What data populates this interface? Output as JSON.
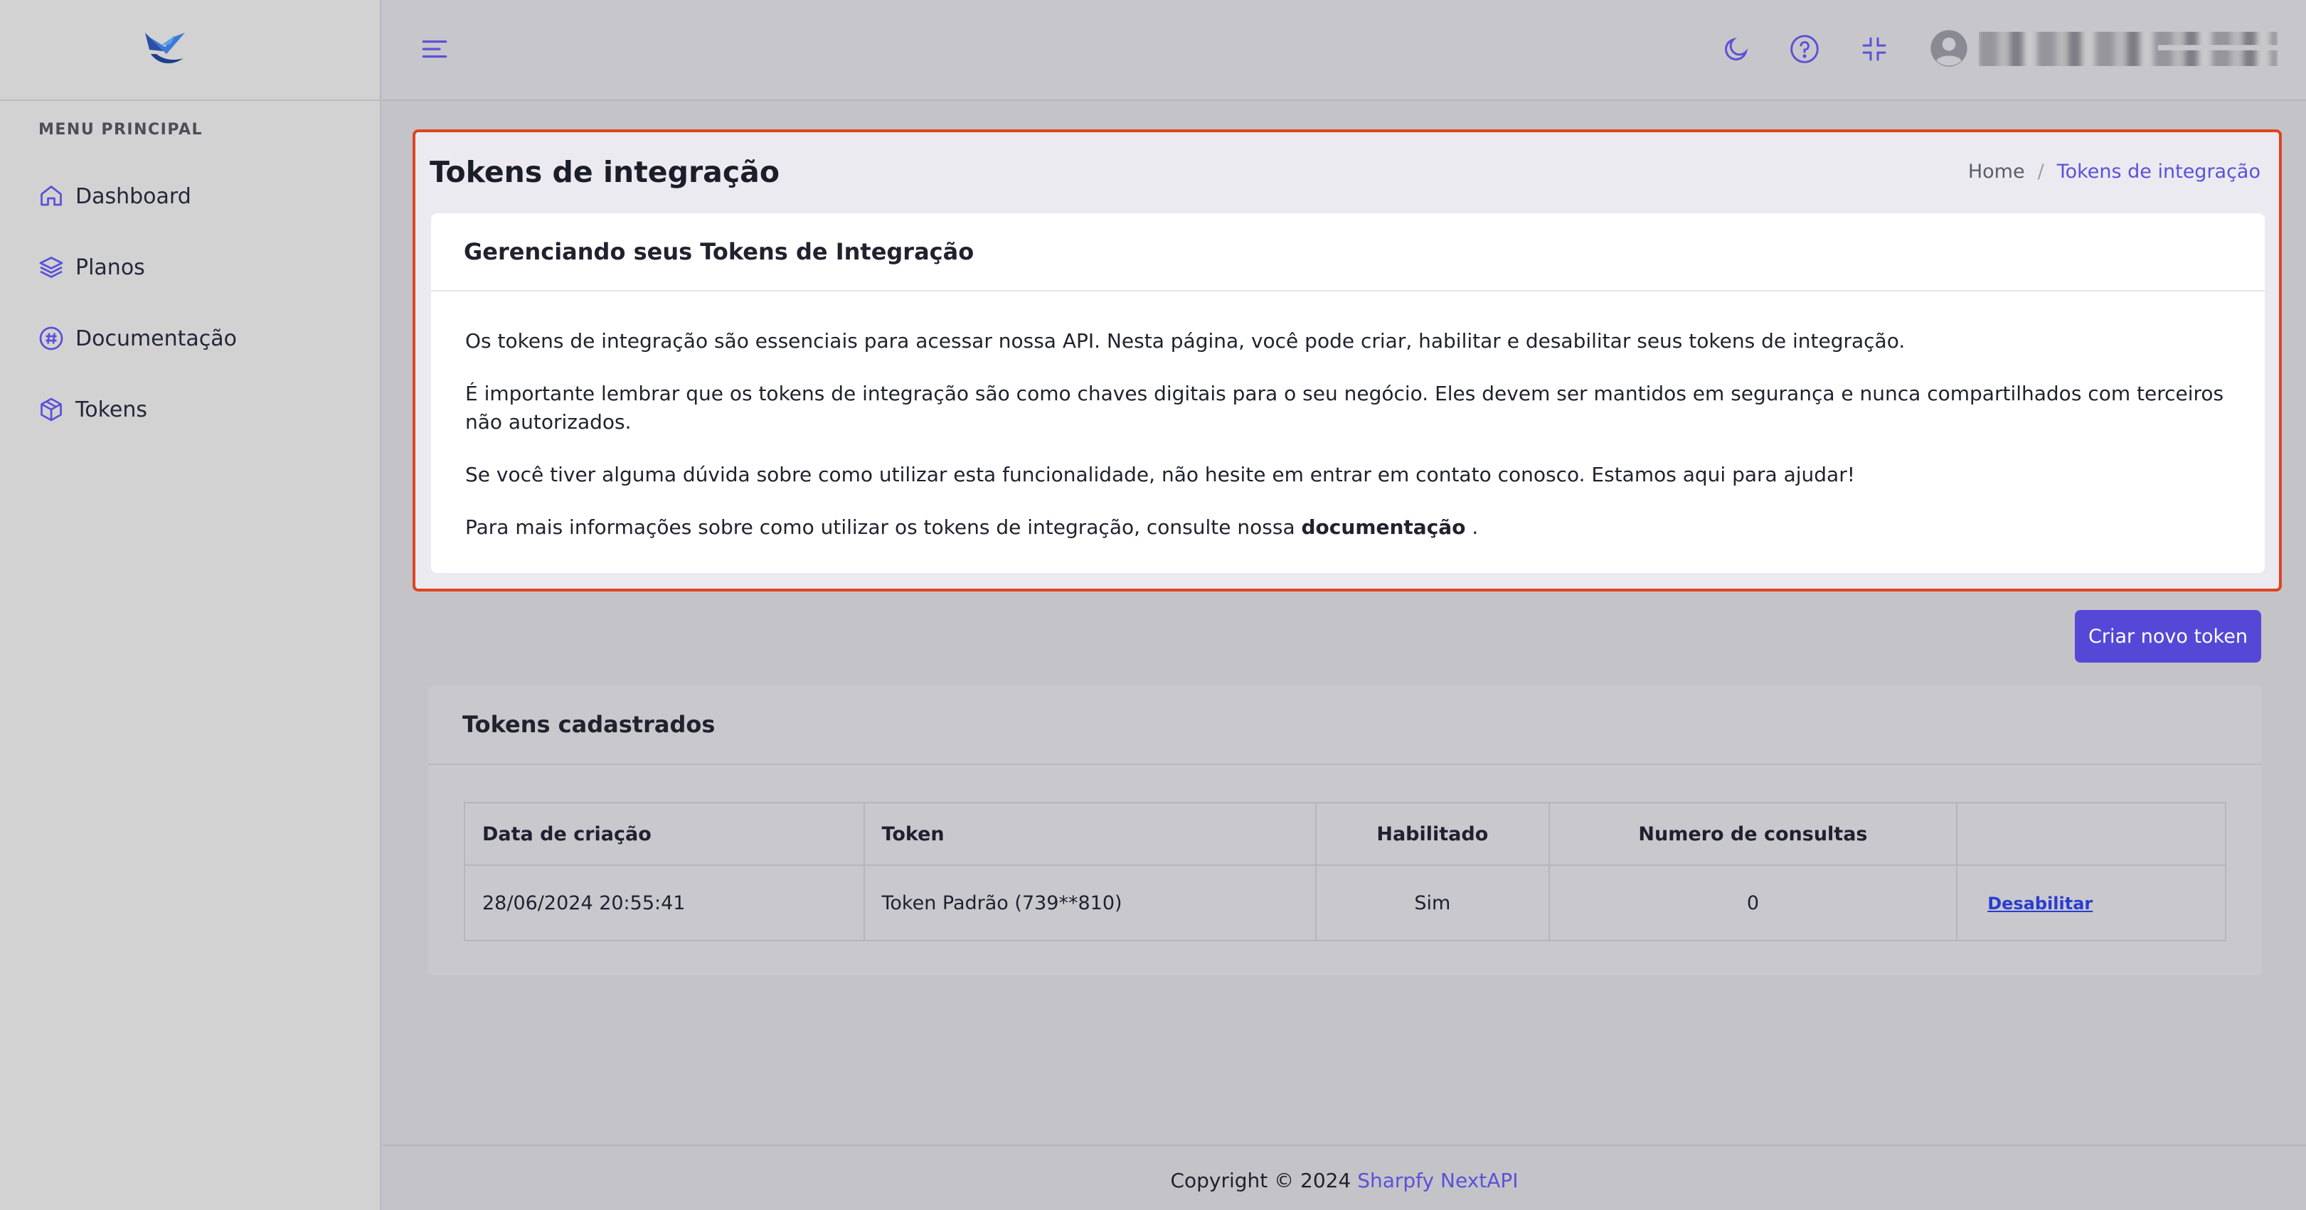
{
  "sidebar": {
    "menu_title": "MENU PRINCIPAL",
    "items": [
      {
        "label": "Dashboard",
        "icon": "home-icon"
      },
      {
        "label": "Planos",
        "icon": "layers-icon"
      },
      {
        "label": "Documentação",
        "icon": "hash-icon"
      },
      {
        "label": "Tokens",
        "icon": "box-icon"
      }
    ]
  },
  "topbar": {
    "icons": [
      "menu-icon",
      "moon-icon",
      "help-icon",
      "minimize-icon",
      "user-avatar-icon"
    ]
  },
  "header": {
    "title": "Tokens de integração",
    "breadcrumb": {
      "home": "Home",
      "separator": "/",
      "current": "Tokens de integração"
    }
  },
  "info": {
    "title": "Gerenciando seus Tokens de Integração",
    "p1": "Os tokens de integração são essenciais para acessar nossa API. Nesta página, você pode criar, habilitar e desabilitar seus tokens de integração.",
    "p2": "É importante lembrar que os tokens de integração são como chaves digitais para o seu negócio. Eles devem ser mantidos em segurança e nunca compartilhados com terceiros não autorizados.",
    "p3": "Se você tiver alguma dúvida sobre como utilizar esta funcionalidade, não hesite em entrar em contato conosco. Estamos aqui para ajudar!",
    "p4_prefix": "Para mais informações sobre como utilizar os tokens de integração, consulte nossa",
    "p4_link": "documentação",
    "p4_suffix": "."
  },
  "actions": {
    "create_label": "Criar novo token"
  },
  "tokens": {
    "title": "Tokens cadastrados",
    "columns": [
      "Data de criação",
      "Token",
      "Habilitado",
      "Numero de consultas",
      ""
    ],
    "rows": [
      {
        "created": "28/06/2024 20:55:41",
        "token": "Token Padrão (739**810)",
        "enabled": "Sim",
        "queries": "0",
        "action": "Desabilitar"
      }
    ]
  },
  "footer": {
    "prefix": "Copyright © 2024",
    "brand": "Sharpfy NextAPI"
  },
  "colors": {
    "accent": "#5548d6",
    "highlight_border": "#e0431f",
    "link": "#2a3cd3"
  }
}
